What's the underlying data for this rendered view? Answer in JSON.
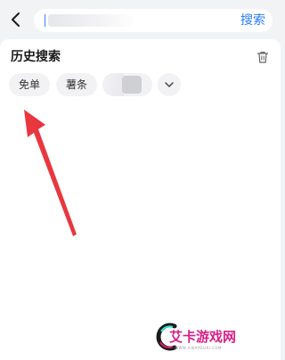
{
  "header": {
    "back_icon": "chevron-left-icon",
    "search_button_label": "搜索",
    "accent_color": "#2a7bf6"
  },
  "history": {
    "title": "历史搜索",
    "delete_icon": "trash-icon",
    "chips": [
      {
        "label": "免单"
      },
      {
        "label": "薯条"
      }
    ],
    "expand_icon": "chevron-down-icon"
  },
  "watermark": {
    "text": "艾卡游戏网",
    "url": "WWW.AIKAYOUXI.COM"
  },
  "annotation": {
    "arrow_color": "#e8373f"
  }
}
